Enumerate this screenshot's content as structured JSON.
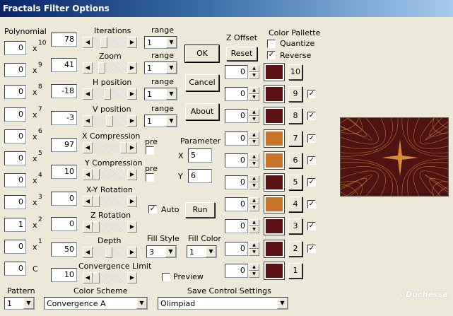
{
  "window": {
    "title": "Fractals Filter Options"
  },
  "polynomial": {
    "label": "Polynomial",
    "terms": [
      {
        "value": "0",
        "suffix": "x",
        "power": "10"
      },
      {
        "value": "0",
        "suffix": "x",
        "power": "9"
      },
      {
        "value": "0",
        "suffix": "x",
        "power": "8"
      },
      {
        "value": "0",
        "suffix": "x",
        "power": "7"
      },
      {
        "value": "0",
        "suffix": "x",
        "power": "6"
      },
      {
        "value": "0",
        "suffix": "x",
        "power": "5"
      },
      {
        "value": "0",
        "suffix": "x",
        "power": "4"
      },
      {
        "value": "0",
        "suffix": "x",
        "power": "3"
      },
      {
        "value": "1",
        "suffix": "x",
        "power": "2"
      },
      {
        "value": "0",
        "suffix": "x",
        "power": "1"
      },
      {
        "value": "0",
        "suffix": "C",
        "power": ""
      }
    ]
  },
  "params": [
    {
      "label": "Iterations",
      "value": "78",
      "range_label": "range",
      "range": "1"
    },
    {
      "label": "Zoom",
      "value": "41",
      "range_label": "range",
      "range": "1"
    },
    {
      "label": "H position",
      "value": "-18",
      "range_label": "range",
      "range": "1"
    },
    {
      "label": "V position",
      "value": "-3",
      "range_label": "range",
      "range": "1"
    },
    {
      "label": "X Compression",
      "value": "97",
      "pre_label": "pre"
    },
    {
      "label": "Y Compression",
      "value": "10",
      "pre_label": "pre"
    },
    {
      "label": "X-Y Rotation",
      "value": "0"
    },
    {
      "label": "Z Rotation",
      "value": "0"
    },
    {
      "label": "Depth",
      "value": "50"
    },
    {
      "label": "Convergence Limit",
      "value": "10"
    }
  ],
  "buttons": {
    "ok": "OK",
    "cancel": "Cancel",
    "about": "About",
    "run": "Run",
    "reset": "Reset"
  },
  "parameter": {
    "label": "Parameter",
    "x_label": "X",
    "x_value": "5",
    "y_label": "Y",
    "y_value": "6"
  },
  "auto": {
    "label": "Auto",
    "checked": true
  },
  "preview_check": {
    "label": "Preview",
    "checked": false
  },
  "fill_style": {
    "label": "Fill Style",
    "value": "3"
  },
  "fill_color": {
    "label": "Fill Color",
    "value": "1"
  },
  "z_offset": {
    "label": "Z Offset"
  },
  "color_pallette": {
    "label": "Color Pallette",
    "quantize": {
      "label": "Quantize",
      "checked": false
    },
    "reverse": {
      "label": "Reverse",
      "checked": true
    },
    "rows": [
      {
        "num": "10",
        "offset": "0",
        "color": "#5a1214",
        "checked": null
      },
      {
        "num": "9",
        "offset": "0",
        "color": "#5a1214",
        "checked": true
      },
      {
        "num": "8",
        "offset": "0",
        "color": "#5a1214",
        "checked": true
      },
      {
        "num": "7",
        "offset": "0",
        "color": "#c8742a",
        "checked": true
      },
      {
        "num": "6",
        "offset": "0",
        "color": "#c8742a",
        "checked": true
      },
      {
        "num": "5",
        "offset": "0",
        "color": "#5a1214",
        "checked": true
      },
      {
        "num": "4",
        "offset": "0",
        "color": "#c8742a",
        "checked": true
      },
      {
        "num": "3",
        "offset": "0",
        "color": "#5a1214",
        "checked": true
      },
      {
        "num": "2",
        "offset": "0",
        "color": "#5a1214",
        "checked": true
      },
      {
        "num": "1",
        "offset": "0",
        "color": "#5a1214",
        "checked": null
      }
    ]
  },
  "pattern": {
    "label": "Pattern",
    "value": "1"
  },
  "color_scheme": {
    "label": "Color Scheme",
    "value": "Convergence A"
  },
  "save_settings": {
    "label": "Save Control Settings",
    "value": "Olimpiad"
  },
  "watermark": "©Duchessa",
  "colors": {
    "preview_bg": "#4e1412",
    "preview_line": "#d9893a"
  }
}
